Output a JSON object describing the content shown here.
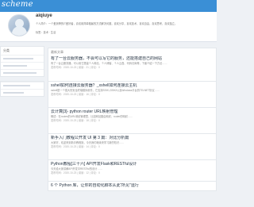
{
  "brand": {
    "logo_text": "scheme",
    "accent": "#3a8fd6"
  },
  "profile": {
    "username": "aiqiuye",
    "bio": "个人简介：一个爱折腾的IT爱好者，喜欢用简单粗暴的方式解决问题，喜欢分享，喜欢技术，喜欢自由，喜欢思考，喜欢独立。",
    "tags": "标签：技术 · 生活"
  },
  "sidebar": {
    "title": "分类",
    "items": [
      "",
      "",
      "",
      "",
      ""
    ]
  },
  "main": {
    "section_title": "最新文章",
    "posts": [
      {
        "title": "有了一台云服务器，不会可以写它的服务，还能搭建自己的网站",
        "excerpt": "有了一台云服务器，可以用它搭建个人网站、个人博客、个人云盘、代码仓库等，下面介绍一下方法……",
        "meta": "发布时间：2020-10-23 | 阅读：21 | 评论：0"
      },
      {
        "title": "xshell如何连接云服务器？_xshell如何连接云主机",
        "excerpt": "xshell是一个强大的安全终端模拟软件，它支持SSH1,SSH2以及Windows平台的TELNET协议……",
        "meta": "发布时间：2020-10-23 | 阅读：16 | 评论：0"
      },
      {
        "title": "云计算[3]- python router URL映射管理",
        "excerpt": "概述：在routes的URL映射管理里，比如网站路由映射、router的映射……",
        "meta": "发布时间：2020-10-23 | 阅读：18 | 评论：0"
      },
      {
        "title": "新手入门教程公开发 UI 第 3 篇：对比分析篇",
        "excerpt": "大家好，欢迎来到新手教程篇，今天我们继续来学习新的知识……",
        "meta": "发布时间：2020-10-23 | 阅读：14 | 评论：0"
      },
      {
        "title": "Python教程[三十六] API开发Flask和RESTful设计",
        "excerpt": "今天给大家讲解API开发中RESTful的设计……",
        "meta": "发布时间：2020-10-23 | 阅读：12 | 评论：0"
      },
      {
        "title": "6 个 Python 库，让你的自动化脚本从此“所见”运行",
        "excerpt": "",
        "meta": ""
      }
    ]
  }
}
